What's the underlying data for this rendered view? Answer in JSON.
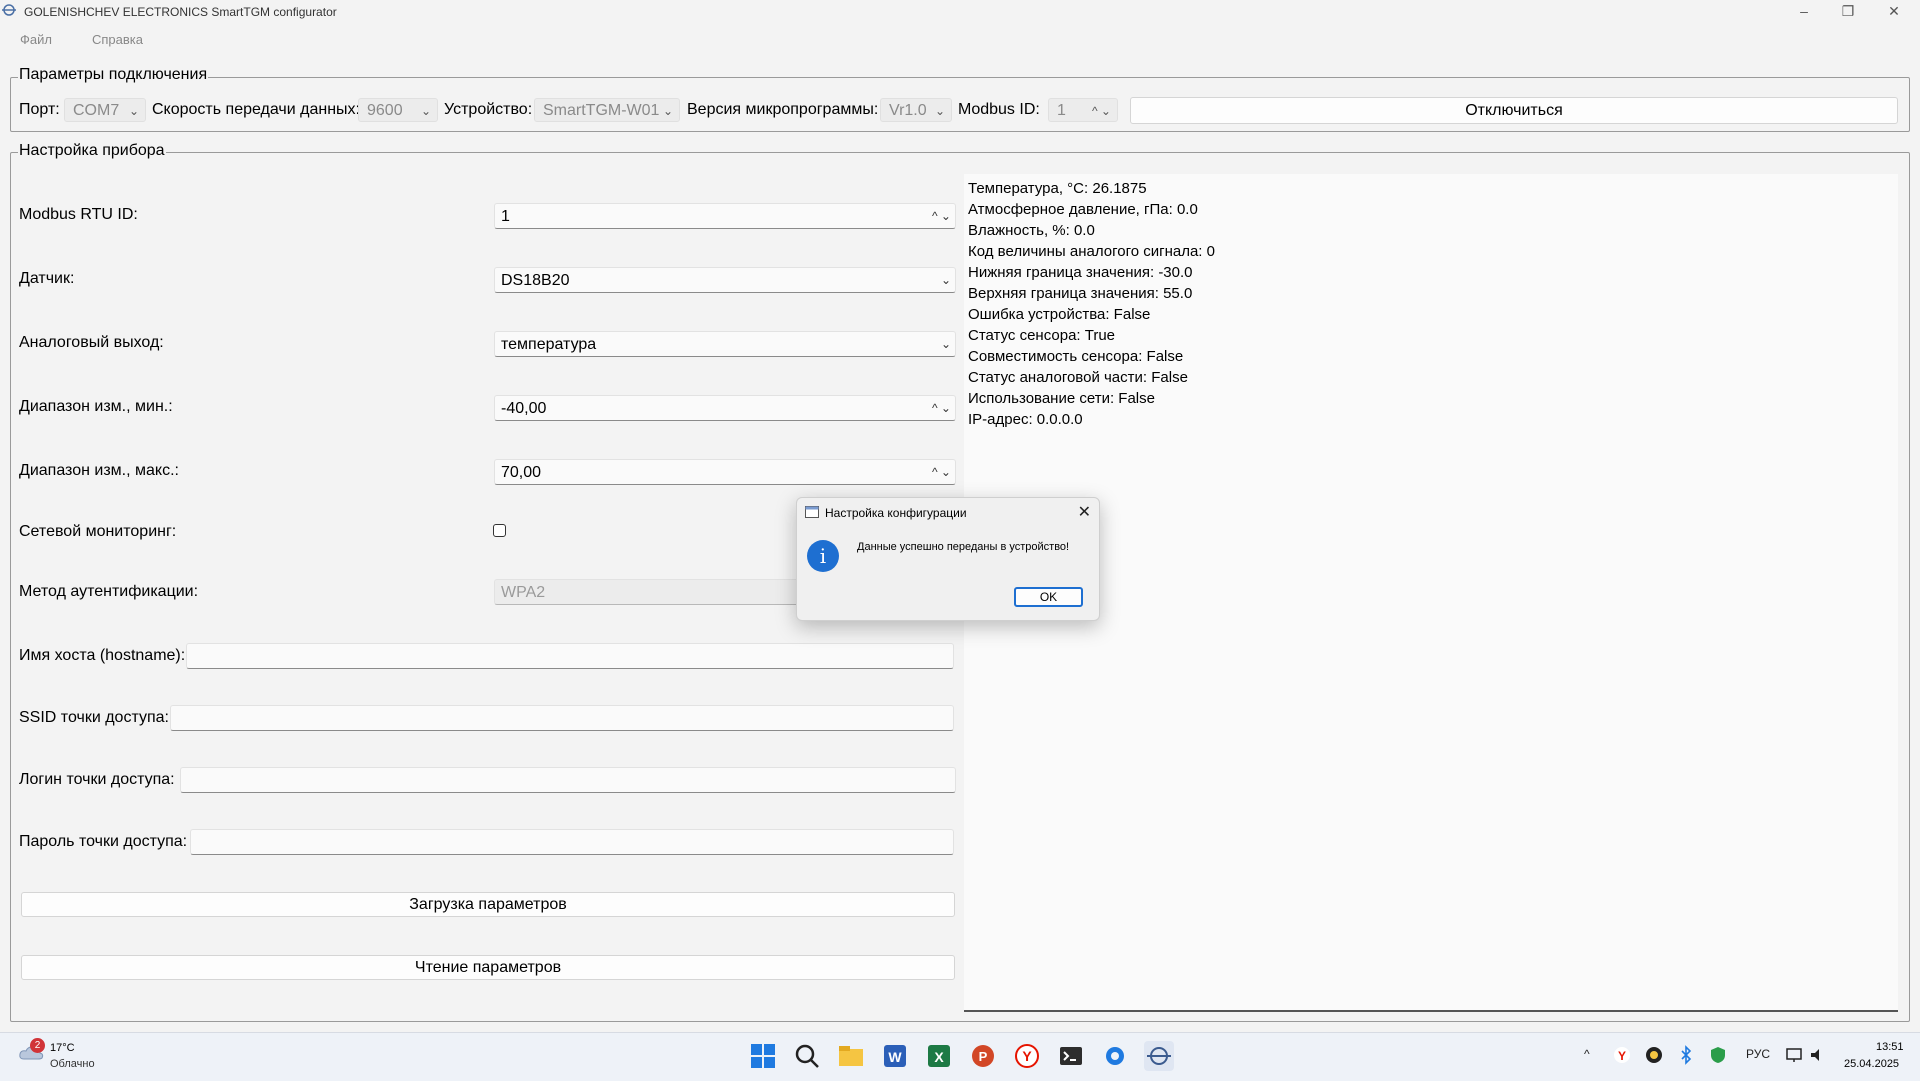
{
  "window": {
    "title": "GOLENISHCHEV ELECTRONICS SmartTGM configurator"
  },
  "menu": {
    "file": "Файл",
    "help": "Справка"
  },
  "connection": {
    "group_title": "Параметры подключения",
    "port_label": "Порт:",
    "port_value": "COM7",
    "baud_label": "Скорость передачи данных:",
    "baud_value": "9600",
    "device_label": "Устройство:",
    "device_value": "SmartTGM-W01",
    "firmware_label": "Версия микропрограммы:",
    "firmware_value": "Vr1.0",
    "modbus_label": "Modbus ID:",
    "modbus_value": "1",
    "disconnect_label": "Отключиться"
  },
  "settings": {
    "group_title": "Настройка прибора",
    "modbus_rtu_label": "Modbus RTU ID:",
    "modbus_rtu_value": "1",
    "sensor_label": "Датчик:",
    "sensor_value": "DS18B20",
    "analog_label": "Аналоговый выход:",
    "analog_value": "температура",
    "range_min_label": "Диапазон изм., мин.:",
    "range_min_value": "-40,00",
    "range_max_label": "Диапазон изм., макс.:",
    "range_max_value": "70,00",
    "net_monitor_label": "Сетевой мониторинг:",
    "net_monitor_checked": false,
    "auth_label": "Метод аутентификации:",
    "auth_value": "WPA2",
    "hostname_label": "Имя хоста (hostname):",
    "hostname_value": "",
    "ssid_label": "SSID точки доступа:",
    "ssid_value": "",
    "login_label": "Логин точки доступа:",
    "login_value": "",
    "password_label": "Пароль точки доступа:",
    "password_value": "",
    "upload_label": "Загрузка параметров",
    "read_label": "Чтение параметров"
  },
  "info": [
    "Температура, °С: 26.1875",
    "Атмосферное давление, гПа: 0.0",
    "Влажность, %: 0.0",
    "Код величины аналогого сигнала: 0",
    "Нижняя граница значения: -30.0",
    "Верхняя граница значения: 55.0",
    "Ошибка устройства: False",
    "Статус сенсора: True",
    "Совместимость сенсора: False",
    "Статус аналоговой части: False",
    "Использование сети: False",
    "IP-адрес: 0.0.0.0"
  ],
  "dialog": {
    "title": "Настройка конфигурации",
    "message": "Данные успешно переданы в устройство!",
    "ok_label": "OK"
  },
  "taskbar": {
    "weather_badge": "2",
    "temperature": "17°C",
    "condition": "Облачно",
    "language": "РУС",
    "time": "13:51",
    "date": "25.04.2025",
    "pinned_apps": [
      "start-icon",
      "search-icon",
      "file-explorer-icon",
      "word-icon",
      "excel-icon",
      "powerpoint-icon",
      "yandex-browser-icon",
      "terminal-icon",
      "settings-icon",
      "smarttgm-configurator-icon"
    ]
  },
  "colors": {
    "accent": "#1e6fd1",
    "window_bg": "#f3f3f3",
    "badge": "#d13438"
  }
}
